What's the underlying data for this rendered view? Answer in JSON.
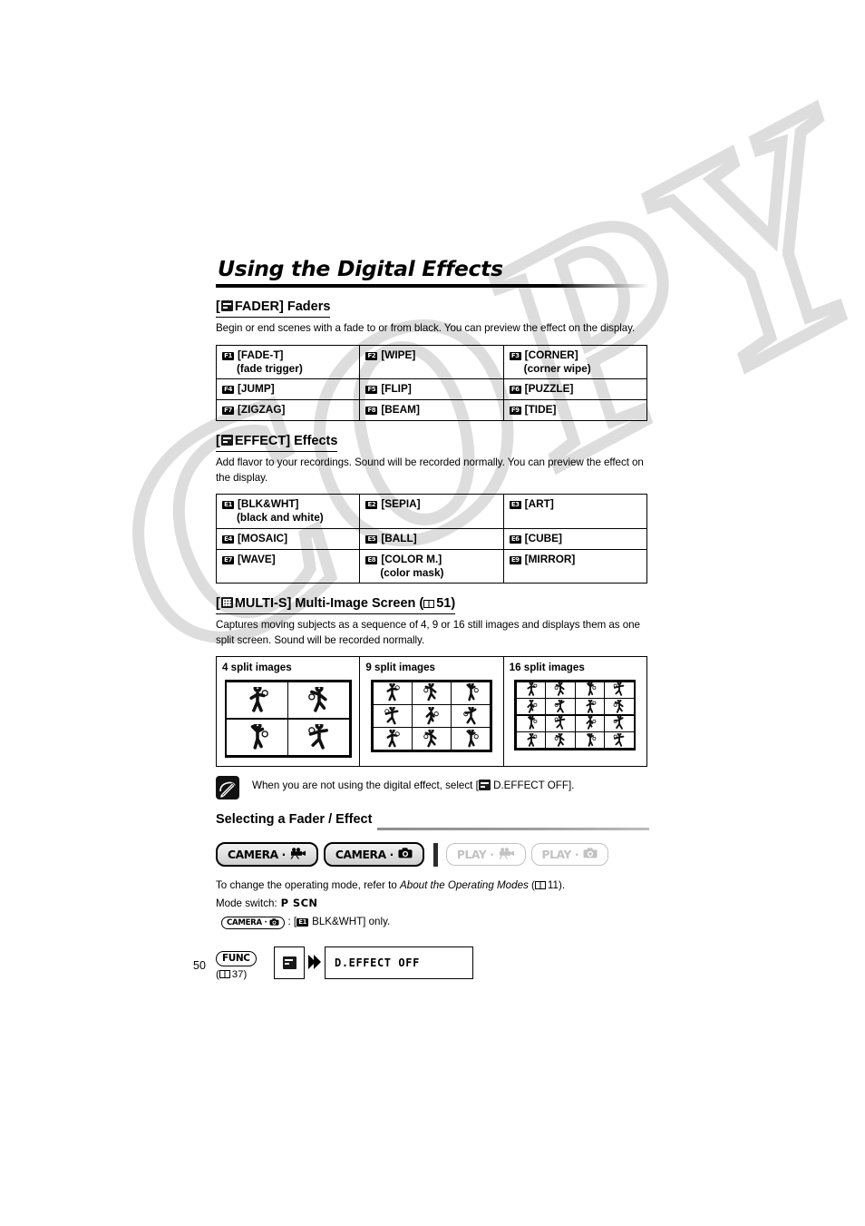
{
  "watermark": {
    "text": "COPY"
  },
  "page": {
    "number": "50"
  },
  "title": "Using the Digital Effects",
  "fader_section": {
    "heading_prefix": "[",
    "heading_icon": "fader-icon",
    "heading_name": "FADER]",
    "heading_suffix": "Faders",
    "description": "Begin or end scenes with a fade to or from black. You can preview the effect on the display.",
    "options": [
      {
        "badge": "F1",
        "label": "[FADE-T]",
        "sub": "(fade trigger)"
      },
      {
        "badge": "F2",
        "label": "[WIPE]",
        "sub": ""
      },
      {
        "badge": "F3",
        "label": "[CORNER]",
        "sub": "(corner wipe)"
      },
      {
        "badge": "F4",
        "label": "[JUMP]",
        "sub": ""
      },
      {
        "badge": "F5",
        "label": "[FLIP]",
        "sub": ""
      },
      {
        "badge": "F6",
        "label": "[PUZZLE]",
        "sub": ""
      },
      {
        "badge": "F7",
        "label": "[ZIGZAG]",
        "sub": ""
      },
      {
        "badge": "F8",
        "label": "[BEAM]",
        "sub": ""
      },
      {
        "badge": "F9",
        "label": "[TIDE]",
        "sub": ""
      }
    ]
  },
  "effect_section": {
    "heading_prefix": "[",
    "heading_icon": "effect-icon",
    "heading_name": "EFFECT]",
    "heading_suffix": "Effects",
    "description": "Add flavor to your recordings. Sound will be recorded normally. You can preview the effect on the display.",
    "options": [
      {
        "badge": "E1",
        "label": "[BLK&WHT]",
        "sub": "(black and white)"
      },
      {
        "badge": "E2",
        "label": "[SEPIA]",
        "sub": ""
      },
      {
        "badge": "E3",
        "label": "[ART]",
        "sub": ""
      },
      {
        "badge": "E4",
        "label": "[MOSAIC]",
        "sub": ""
      },
      {
        "badge": "E5",
        "label": "[BALL]",
        "sub": ""
      },
      {
        "badge": "E6",
        "label": "[CUBE]",
        "sub": ""
      },
      {
        "badge": "E7",
        "label": "[WAVE]",
        "sub": ""
      },
      {
        "badge": "E8",
        "label": "[COLOR M.]",
        "sub": "(color mask)"
      },
      {
        "badge": "E9",
        "label": "[MIRROR]",
        "sub": ""
      }
    ]
  },
  "multis_section": {
    "heading_prefix": "[",
    "heading_icon": "multi-screen-icon",
    "heading_name": "MULTI-S]",
    "heading_title": "Multi-Image Screen (",
    "heading_page_ref": "51",
    "heading_close": ")",
    "description": "Captures moving subjects as a sequence of 4, 9 or 16 still images and displays them as one split screen. Sound will be recorded normally.",
    "columns": [
      {
        "label": "4 split images",
        "cells": 4
      },
      {
        "label": "9 split images",
        "cells": 9
      },
      {
        "label": "16 split images",
        "cells": 16
      }
    ]
  },
  "note": {
    "icon": "note-pencil-icon",
    "text_before": "When you are not using the digital effect, select [",
    "inline_icon": "d-effect-off-icon",
    "text_after": "D.EFFECT OFF]."
  },
  "selecting_section": {
    "heading": "Selecting a Fader / Effect",
    "modes": [
      {
        "label": "CAMERA ·",
        "icon": "movie-camera-icon",
        "state": "on"
      },
      {
        "label": "CAMERA ·",
        "icon": "photo-camera-icon",
        "state": "on"
      },
      {
        "label": "PLAY ·",
        "icon": "movie-camera-icon",
        "state": "off"
      },
      {
        "label": "PLAY ·",
        "icon": "photo-camera-icon",
        "state": "off"
      }
    ],
    "operating_modes_text_before": "To change the operating mode, refer to ",
    "operating_modes_italic": "About the Operating Modes",
    "operating_modes_text_paren_open": " (",
    "operating_modes_page": "11",
    "operating_modes_text_after": ").",
    "mode_switch_label": "Mode switch:",
    "mode_switch_value": "P  SCN",
    "camera_only_pill": "CAMERA ·",
    "camera_only_text_before": ": [",
    "camera_only_badge": "E1",
    "camera_only_text_after": "BLK&WHT] only."
  },
  "func_flow": {
    "func_label": "FUNC",
    "func_page_ref": "37",
    "icon": "d-effect-icon",
    "arrow": "double-chevron-right-icon",
    "value": "D.EFFECT OFF"
  }
}
